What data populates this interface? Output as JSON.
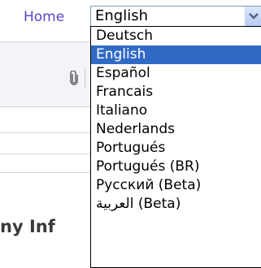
{
  "header": {
    "home_label": "Home"
  },
  "language_select": {
    "selected_value": "English",
    "options": [
      "Deutsch",
      "English",
      "Español",
      "Francais",
      "Italiano",
      "Nederlands",
      "Portugués",
      "Portugués (BR)",
      "Русский (Beta)",
      "العربية (Beta)"
    ],
    "highlighted_option": "English"
  },
  "background": {
    "heading_fragment": "ny Inf"
  },
  "colors": {
    "link": "#5b42c8",
    "selection": "#316ac5",
    "select_border": "#7f9db9"
  },
  "icons": {
    "attachment": "paperclip-icon",
    "dropdown": "chevron-down-icon"
  }
}
